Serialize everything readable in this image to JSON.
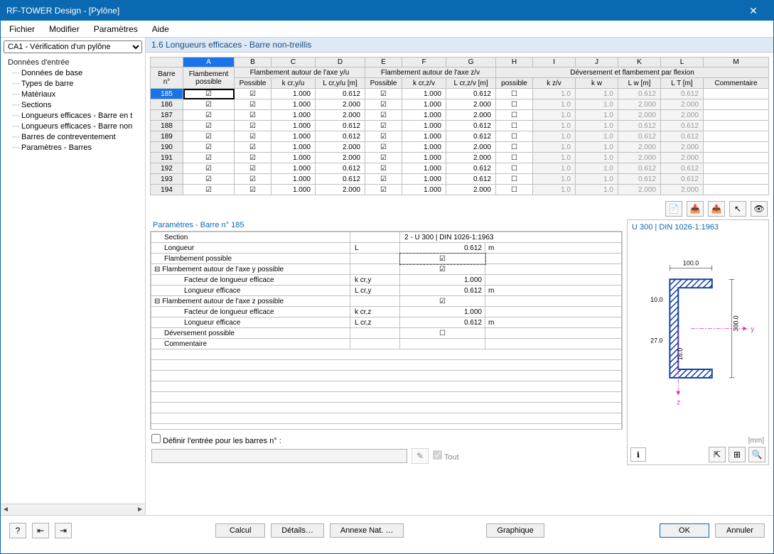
{
  "window": {
    "title": "RF-TOWER Design - [Pylône]"
  },
  "menu": {
    "file": "Fichier",
    "edit": "Modifier",
    "params": "Paramètres",
    "help": "Aide"
  },
  "sidebar": {
    "case": "CA1 - Vérification d'un pylône",
    "root": "Données d'entrée",
    "items": [
      "Données de base",
      "Types de barre",
      "Matériaux",
      "Sections",
      "Longueurs efficaces - Barre en t",
      "Longueurs efficaces - Barre non",
      "Barres de contreventement",
      "Paramètres - Barres"
    ]
  },
  "section_title": "1.6 Longueurs efficaces - Barre non-treillis",
  "grid": {
    "letters": [
      "A",
      "B",
      "C",
      "D",
      "E",
      "F",
      "G",
      "H",
      "I",
      "J",
      "K",
      "L",
      "M"
    ],
    "header_row1": [
      "Barre",
      "Flambement",
      "Flambement autour de l'axe y/u",
      "Flambement autour de l'axe z/v",
      "Déversement et flambement par flexion"
    ],
    "header_row2": [
      "n°",
      "possible",
      "Possible",
      "k cr,y/u",
      "L cr,y/u [m]",
      "Possible",
      "k cr,z/v",
      "L cr,z/v [m]",
      "possible",
      "k z/v",
      "k w",
      "L w [m]",
      "L T [m]",
      "Commentaire"
    ],
    "rows": [
      {
        "n": "185",
        "a": true,
        "b": true,
        "c": "1.000",
        "d": "0.612",
        "e": true,
        "f": "1.000",
        "g": "0.612",
        "h": false,
        "i": "1.0",
        "j": "1.0",
        "k": "0.612",
        "l": "0.612",
        "m": ""
      },
      {
        "n": "186",
        "a": true,
        "b": true,
        "c": "1.000",
        "d": "2.000",
        "e": true,
        "f": "1.000",
        "g": "2.000",
        "h": false,
        "i": "1.0",
        "j": "1.0",
        "k": "2.000",
        "l": "2.000",
        "m": ""
      },
      {
        "n": "187",
        "a": true,
        "b": true,
        "c": "1.000",
        "d": "2.000",
        "e": true,
        "f": "1.000",
        "g": "2.000",
        "h": false,
        "i": "1.0",
        "j": "1.0",
        "k": "2.000",
        "l": "2.000",
        "m": ""
      },
      {
        "n": "188",
        "a": true,
        "b": true,
        "c": "1.000",
        "d": "0.612",
        "e": true,
        "f": "1.000",
        "g": "0.612",
        "h": false,
        "i": "1.0",
        "j": "1.0",
        "k": "0.612",
        "l": "0.612",
        "m": ""
      },
      {
        "n": "189",
        "a": true,
        "b": true,
        "c": "1.000",
        "d": "0.612",
        "e": true,
        "f": "1.000",
        "g": "0.612",
        "h": false,
        "i": "1.0",
        "j": "1.0",
        "k": "0.612",
        "l": "0.612",
        "m": ""
      },
      {
        "n": "190",
        "a": true,
        "b": true,
        "c": "1.000",
        "d": "2.000",
        "e": true,
        "f": "1.000",
        "g": "2.000",
        "h": false,
        "i": "1.0",
        "j": "1.0",
        "k": "2.000",
        "l": "2.000",
        "m": ""
      },
      {
        "n": "191",
        "a": true,
        "b": true,
        "c": "1.000",
        "d": "2.000",
        "e": true,
        "f": "1.000",
        "g": "2.000",
        "h": false,
        "i": "1.0",
        "j": "1.0",
        "k": "2.000",
        "l": "2.000",
        "m": ""
      },
      {
        "n": "192",
        "a": true,
        "b": true,
        "c": "1.000",
        "d": "0.612",
        "e": true,
        "f": "1.000",
        "g": "0.612",
        "h": false,
        "i": "1.0",
        "j": "1.0",
        "k": "0.612",
        "l": "0.612",
        "m": ""
      },
      {
        "n": "193",
        "a": true,
        "b": true,
        "c": "1.000",
        "d": "0.612",
        "e": true,
        "f": "1.000",
        "g": "0.612",
        "h": false,
        "i": "1.0",
        "j": "1.0",
        "k": "0.612",
        "l": "0.612",
        "m": ""
      },
      {
        "n": "194",
        "a": true,
        "b": true,
        "c": "1.000",
        "d": "2.000",
        "e": true,
        "f": "1.000",
        "g": "2.000",
        "h": false,
        "i": "1.0",
        "j": "1.0",
        "k": "2.000",
        "l": "2.000",
        "m": ""
      }
    ]
  },
  "params": {
    "title": "Paramètres - Barre n° 185",
    "section_label": "Section",
    "section_value": "2 - U 300 | DIN 1026-1:1963",
    "length_label": "Longueur",
    "length_sym": "L",
    "length_val": "0.612",
    "length_unit": "m",
    "buck_possible": "Flambement possible",
    "buck_y": "Flambement autour de l'axe y possible",
    "k_label": "Facteur de longueur efficace",
    "k_y_sym": "k cr,y",
    "k_y_val": "1.000",
    "L_label": "Longueur efficace",
    "L_y_sym": "L cr,y",
    "L_y_val": "0.612",
    "unit_m": "m",
    "buck_z": "Flambement autour de l'axe z possible",
    "k_z_sym": "k cr,z",
    "k_z_val": "1.000",
    "L_z_sym": "L cr,z",
    "L_z_val": "0.612",
    "dev_possible": "Déversement possible",
    "comment": "Commentaire"
  },
  "define": {
    "label": "Définir l'entrée pour les barres n° :",
    "all": "Tout"
  },
  "profile": {
    "title": "U 300 | DIN 1026-1:1963",
    "unit": "[mm]",
    "dim_width": "100.0",
    "dim_height": "300.0",
    "dim_flange": "10.0",
    "dim_web": "27.0",
    "dim_t": "16.0",
    "axis_y": "y",
    "axis_z": "z"
  },
  "buttons": {
    "calc": "Calcul",
    "details": "Détails…",
    "annex": "Annexe Nat. …",
    "graph": "Graphique",
    "ok": "OK",
    "cancel": "Annuler"
  }
}
